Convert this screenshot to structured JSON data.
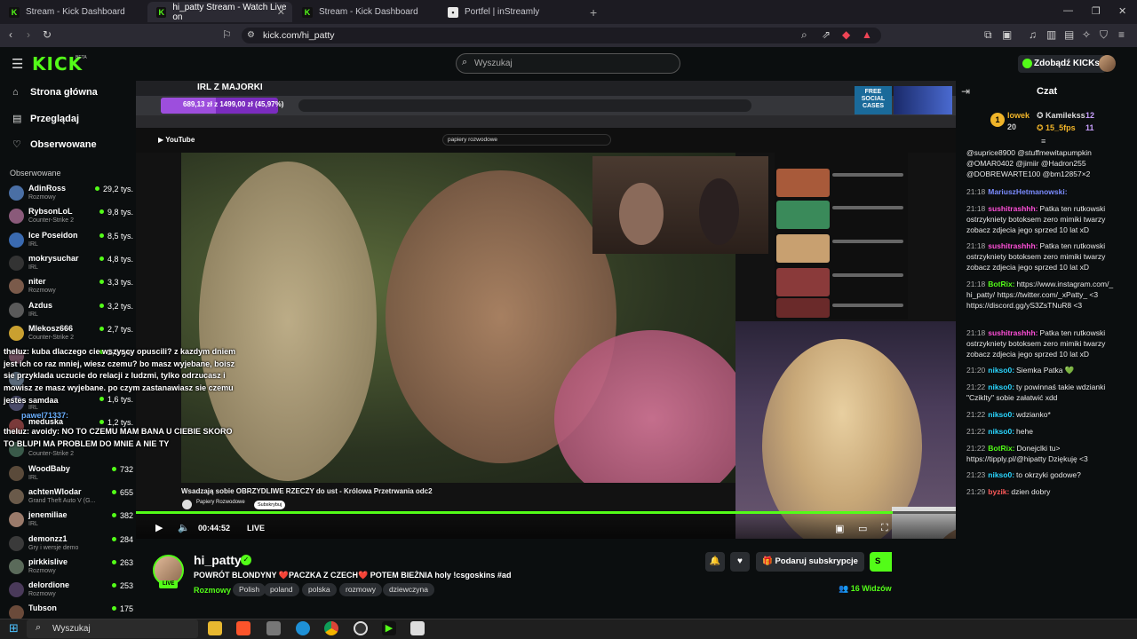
{
  "browser": {
    "tabs": [
      {
        "label": "Stream - Kick Dashboard",
        "icon": "kick-icon"
      },
      {
        "label": "hi_patty Stream - Watch Live on",
        "icon": "kick-icon",
        "active": true
      },
      {
        "label": "Stream - Kick Dashboard",
        "icon": "kick-icon"
      },
      {
        "label": "Portfel | inStreamly",
        "icon": "instreamly-icon"
      }
    ],
    "url": "kick.com/hi_patty"
  },
  "topbar": {
    "logo": "KICK",
    "beta": "BETA",
    "search_placeholder": "Wyszukaj",
    "kicks_button": "Zdobądź KICKs"
  },
  "sidebar": {
    "nav": [
      {
        "label": "Strona główna",
        "icon": "home-icon"
      },
      {
        "label": "Przeglądaj",
        "icon": "browse-icon"
      },
      {
        "label": "Obserwowane",
        "icon": "heart-icon"
      }
    ],
    "following_header": "Obserwowane",
    "channels": [
      {
        "name": "AdinRoss",
        "game": "Rozmowy",
        "viewers": "29,2 tys.",
        "color": "#4a6fa5"
      },
      {
        "name": "RybsonLoL",
        "game": "Counter-Strike 2",
        "viewers": "9,8 tys.",
        "color": "#8a5a7a"
      },
      {
        "name": "Ice Poseidon",
        "game": "IRL",
        "viewers": "8,5 tys.",
        "color": "#3a6ab0"
      },
      {
        "name": "mokrysuchar",
        "game": "IRL",
        "viewers": "4,8 tys.",
        "color": "#333"
      },
      {
        "name": "niter",
        "game": "Rozmowy",
        "viewers": "3,3 tys.",
        "color": "#7a5a4a"
      },
      {
        "name": "Azdus",
        "game": "IRL",
        "viewers": "3,2 tys.",
        "color": "#5a5a5a"
      },
      {
        "name": "Mlekosz666",
        "game": "Counter-Strike 2",
        "viewers": "2,7 tys.",
        "color": "#c9a030"
      },
      {
        "name": "",
        "game": "",
        "viewers": "2,5 tys.",
        "color": "#6a4a5a"
      },
      {
        "name": "",
        "game": "",
        "viewers": "",
        "color": "#5a6a7a"
      },
      {
        "name": "",
        "game": "IRL",
        "viewers": "1,6 tys.",
        "color": "#4a4a6a"
      },
      {
        "name": "meduska",
        "game": "",
        "viewers": "1,2 tys.",
        "color": "#7a3a3a"
      },
      {
        "name": "",
        "game": "Counter-Strike 2",
        "viewers": "",
        "color": "#3a5a4a"
      },
      {
        "name": "WoodBaby",
        "game": "IRL",
        "viewers": "732",
        "color": "#5a4a3a"
      },
      {
        "name": "achtenWlodar",
        "game": "Grand Theft Auto V (G...",
        "viewers": "655",
        "color": "#6a5a4a"
      },
      {
        "name": "jenemiliae",
        "game": "IRL",
        "viewers": "382",
        "color": "#9a7a6a"
      },
      {
        "name": "demonzz1",
        "game": "Gry i wersje demo",
        "viewers": "284",
        "color": "#3a3a3a"
      },
      {
        "name": "pirkkislive",
        "game": "Rozmowy",
        "viewers": "263",
        "color": "#5a6a5a"
      },
      {
        "name": "delordione",
        "game": "Rozmowy",
        "viewers": "253",
        "color": "#4a3a5a"
      },
      {
        "name": "Tubson",
        "game": "",
        "viewers": "175",
        "color": "#6a4a3a"
      }
    ]
  },
  "overlay_chat": [
    "theluz: kuba dlaczego cie wszyscy opuscili? z kazdym dniem",
    "jest ich co raz mniej, wiesz czemu? bo masz wyjebane, boisz",
    "sie przyklada uczucie do relacji z ludzmi, tylko odrzucasz i",
    "mowisz ze masz wyjebane. po czym zastanawiasz sie czemu",
    "jestes samdaa",
    "pawel71337:",
    "theluz: avoidy: NO TO CZEMU MAM BANA U CIEBIE SKORO",
    "TO BLUPI MA PROBLEM DO MNIE A NIE TY"
  ],
  "video": {
    "inner_label": "IRL Z MAJORKI",
    "donation": "689,13 zł z 1499,00 zł (45,97%)",
    "donation_progress": 0.4597,
    "yt_search": "papiery rozwodowe",
    "caption": "Wsadzają sobie OBRZYDLIWE RZECZY do ust - Królowa Przetrwania odc2",
    "channel": "Papiery Rozwodowe",
    "subscribe": "Subskrybuj",
    "banner": "FREE SOCIAL CASES",
    "time": "00:44:52",
    "live": "LIVE"
  },
  "stream": {
    "name": "hi_patty",
    "live_badge": "LIVE",
    "title": "POWRÓT BLONDYNY ❤️PACZKA Z CZECH❤️ POTEM BIEŻNIA holy !csgoskins #ad",
    "category": "Rozmowy",
    "tags": [
      "Polish",
      "poland",
      "polska",
      "rozmowy",
      "dziewczyna"
    ],
    "gift_button": "Podaruj subskrypcje",
    "subscribe_button": "S",
    "viewers": "16 Widzów"
  },
  "chat": {
    "header": "Czat",
    "podium": [
      {
        "name": "lowek",
        "count": "20"
      },
      {
        "name": "Kamilekss",
        "count": "12"
      },
      {
        "name": "15_5fps",
        "count": "11"
      }
    ],
    "messages": [
      {
        "ts": "",
        "user": "",
        "color": "#fff",
        "text": "@suprice8900 @stuffmewitapumpkin @OMAR0402 @jimiir @Hadron255 @DOBREWARTE100 @bm12857×2"
      },
      {
        "ts": "21:18",
        "user": "MariuszHetmanowski:",
        "color": "#7b8cff",
        "text": ""
      },
      {
        "ts": "21:18",
        "user": "sushitrashhh:",
        "color": "#ff4fd8",
        "text": "Patka ten rutkowski ostrzykniety botoksem zero mimiki twarzy zobacz zdjecia jego sprzed 10 lat xD"
      },
      {
        "ts": "21:18",
        "user": "sushitrashhh:",
        "color": "#ff4fd8",
        "text": "Patka ten rutkowski ostrzykniety botoksem zero mimiki twarzy zobacz zdjecia jego sprzed 10 lat xD"
      },
      {
        "ts": "21:18",
        "user": "BotRix:",
        "color": "#53fc18",
        "text": "https://www.instagram.com/_hi_patty/ https://twitter.com/_xPatty_ <3 https://discord.gg/yS3ZsTNuR8 <3"
      },
      {
        "ts": "21:18",
        "user": "sushitrashhh:",
        "color": "#ff4fd8",
        "text": "Patka ten rutkowski ostrzykniety botoksem zero mimiki twarzy zobacz zdjecia jego sprzed 10 lat xD"
      },
      {
        "ts": "21:20",
        "user": "nikso0:",
        "color": "#2ad6ff",
        "text": "Siemka Patka 💚"
      },
      {
        "ts": "21:22",
        "user": "nikso0:",
        "color": "#2ad6ff",
        "text": "ty powinnaś takie wdzianki \"Cziklty\" sobie załatwić xdd"
      },
      {
        "ts": "21:22",
        "user": "nikso0:",
        "color": "#2ad6ff",
        "text": "wdzianko*"
      },
      {
        "ts": "21:22",
        "user": "nikso0:",
        "color": "#2ad6ff",
        "text": "hehe"
      },
      {
        "ts": "21:22",
        "user": "BotRix:",
        "color": "#53fc18",
        "text": "Donejclki tu> https://tipply.pl/@hipatty Dziękuję <3"
      },
      {
        "ts": "21:23",
        "user": "nikso0:",
        "color": "#2ad6ff",
        "text": "to okrzyki godowe?"
      },
      {
        "ts": "21:29",
        "user": "byzik:",
        "color": "#ff5a5a",
        "text": "dzien dobry"
      }
    ]
  },
  "taskbar": {
    "search": "Wyszukaj"
  }
}
